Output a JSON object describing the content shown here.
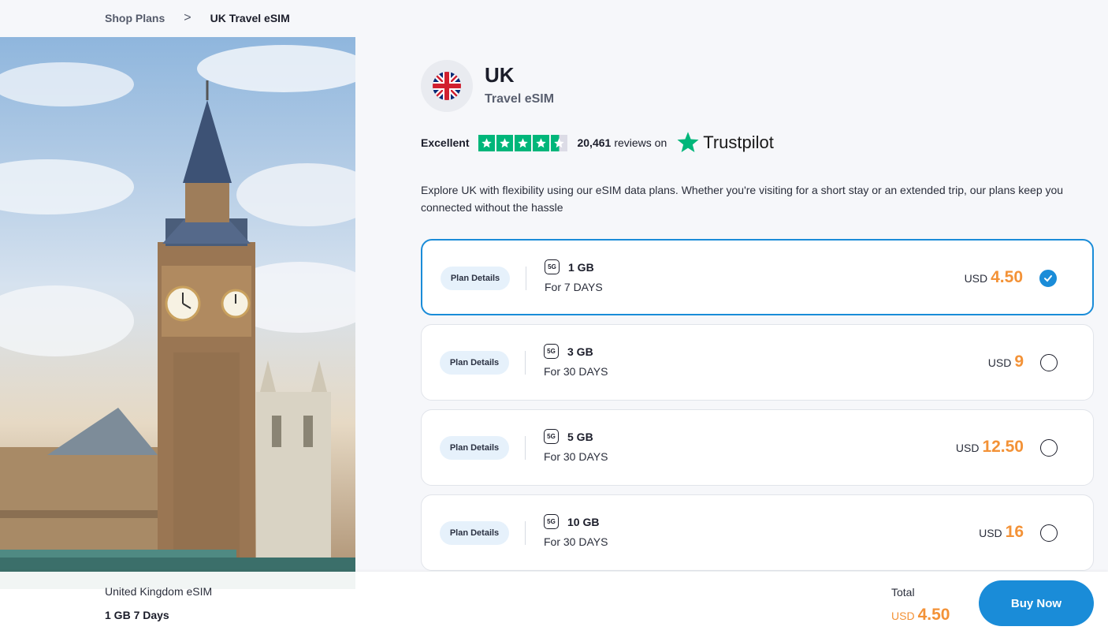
{
  "breadcrumb": {
    "items": [
      "Shop Plans",
      "UK Travel eSIM"
    ],
    "separator": ">"
  },
  "product": {
    "title": "UK",
    "subtitle": "Travel eSIM",
    "flag_icon": "uk-flag-icon"
  },
  "rating": {
    "label": "Excellent",
    "stars": 4.5,
    "reviews_count": "20,461",
    "reviews_text": "reviews on",
    "platform": "Trustpilot"
  },
  "description": "Explore UK with flexibility using our eSIM data plans. Whether you're visiting for a short stay or an extended trip, our plans keep you connected without the hassle",
  "plans": [
    {
      "details_label": "Plan Details",
      "data": "1 GB",
      "duration": "For 7 DAYS",
      "currency": "USD",
      "price": "4.50",
      "selected": true
    },
    {
      "details_label": "Plan Details",
      "data": "3 GB",
      "duration": "For 30 DAYS",
      "currency": "USD",
      "price": "9",
      "selected": false
    },
    {
      "details_label": "Plan Details",
      "data": "5 GB",
      "duration": "For 30 DAYS",
      "currency": "USD",
      "price": "12.50",
      "selected": false
    },
    {
      "details_label": "Plan Details",
      "data": "10 GB",
      "duration": "For 30 DAYS",
      "currency": "USD",
      "price": "16",
      "selected": false
    }
  ],
  "network_badge": "5G",
  "bottom_bar": {
    "product_name": "United Kingdom eSIM",
    "selected_plan": "1 GB 7 Days",
    "total_label": "Total",
    "total_currency": "USD",
    "total_price": "4.50",
    "buy_label": "Buy Now"
  },
  "colors": {
    "accent": "#1a8cd8",
    "price": "#f39237",
    "trustpilot": "#00b67a"
  }
}
